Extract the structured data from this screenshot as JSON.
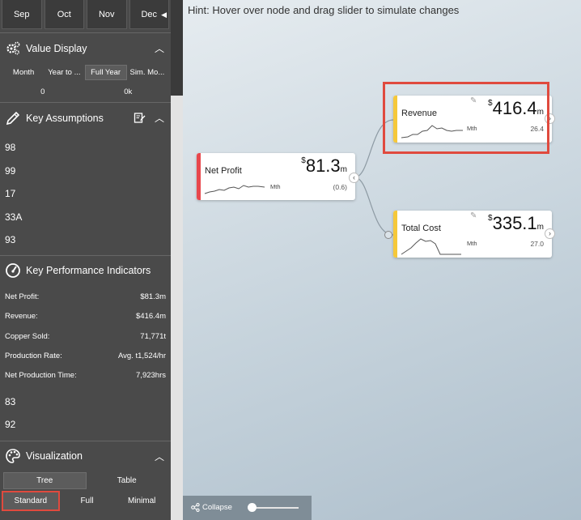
{
  "months": [
    "Sep",
    "Oct",
    "Nov",
    "Dec"
  ],
  "value_display": {
    "title": "Value Display",
    "options": [
      "Month",
      "Year to ...",
      "Full Year",
      "Sim. Mo..."
    ],
    "active": "Full Year",
    "slider_min": "0",
    "slider_max": "0k"
  },
  "key_assumptions": {
    "title": "Key Assumptions",
    "items": [
      "98",
      "99",
      "17",
      "33A",
      "93"
    ]
  },
  "kpi": {
    "title": "Key Performance Indicators",
    "rows": [
      {
        "label": "Net Profit:",
        "value": "$81.3m"
      },
      {
        "label": "Revenue:",
        "value": "$416.4m"
      },
      {
        "label": "Copper Sold:",
        "value": "71,771t"
      },
      {
        "label": "Production Rate:",
        "value": "Avg. t1,524/hr"
      },
      {
        "label": "Net Production Time:",
        "value": "7,923hrs"
      }
    ],
    "extra": [
      "83",
      "92"
    ]
  },
  "visualization": {
    "title": "Visualization",
    "tabs": [
      "Tree",
      "Table"
    ],
    "active_tab": "Tree",
    "modes": [
      "Standard",
      "Full",
      "Minimal"
    ],
    "active_mode": "Standard"
  },
  "canvas": {
    "hint": "Hint: Hover over node and drag slider to simulate changes",
    "collapse_label": "Collapse",
    "zoom_level": 0
  },
  "nodes": {
    "net_profit": {
      "label": "Net Profit",
      "currency": "$",
      "value": "81.3",
      "unit": "m",
      "period": "Mth",
      "delta": "(0.6)",
      "color": "#e8474c"
    },
    "revenue": {
      "label": "Revenue",
      "currency": "$",
      "value": "416.4",
      "unit": "m",
      "period": "Mth",
      "delta": "26.4",
      "color": "#f5c83a"
    },
    "total_cost": {
      "label": "Total Cost",
      "currency": "$",
      "value": "335.1",
      "unit": "m",
      "period": "Mth",
      "delta": "27.0",
      "color": "#f5c83a"
    }
  },
  "colors": {
    "highlight": "#e04a3e",
    "sidebar_bg": "#4a4a4a"
  }
}
